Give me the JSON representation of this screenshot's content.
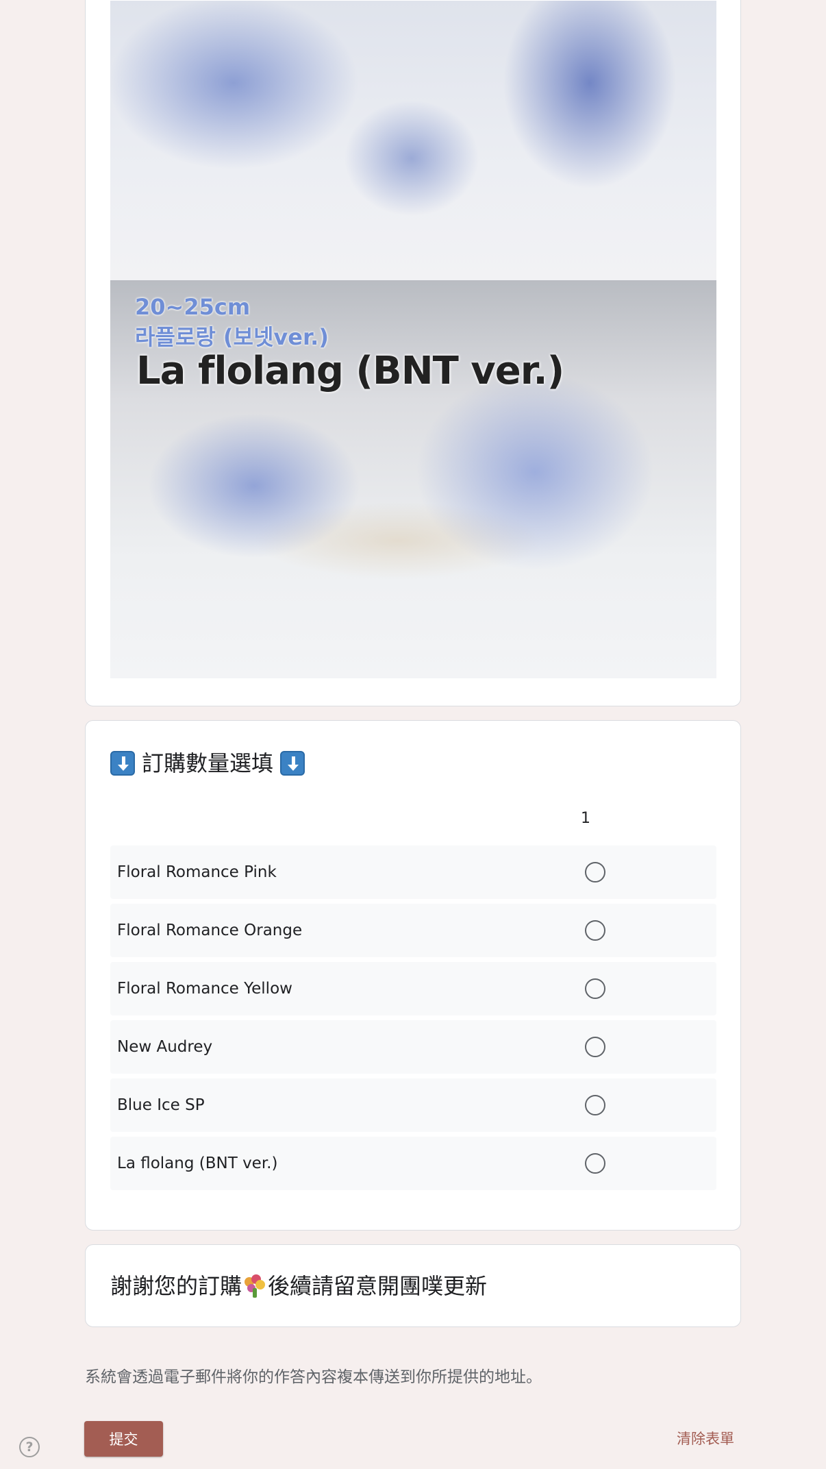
{
  "image_card": {
    "caption_size": "20~25cm",
    "caption_korean": "라플로랑 (보넷ver.)",
    "caption_title": "La flolang (BNT ver.)"
  },
  "grid_question": {
    "title": "訂購數量選填",
    "leading_icon": "arrow-down-icon",
    "trailing_icon": "arrow-down-icon",
    "column_headers": [
      "1"
    ],
    "rows": [
      {
        "label": "Floral Romance Pink",
        "selected": false
      },
      {
        "label": "Floral Romance Orange",
        "selected": false
      },
      {
        "label": "Floral Romance Yellow",
        "selected": false
      },
      {
        "label": "New Audrey",
        "selected": false
      },
      {
        "label": "Blue Ice SP",
        "selected": false
      },
      {
        "label": "La flolang (BNT ver.)",
        "selected": false
      }
    ]
  },
  "thanks": {
    "text_before": "謝謝您的訂購",
    "icon": "bouquet-icon",
    "text_after": "後續請留意開團噗更新"
  },
  "footer": {
    "notice": "系統會透過電子郵件將你的作答內容複本傳送到你所提供的地址。",
    "submit_label": "提交",
    "clear_label": "清除表單",
    "help_icon": "help-icon"
  },
  "colors": {
    "page_background": "#f6efee",
    "accent": "#a35d53",
    "card_background": "#ffffff",
    "row_background": "#f8f9fa"
  }
}
